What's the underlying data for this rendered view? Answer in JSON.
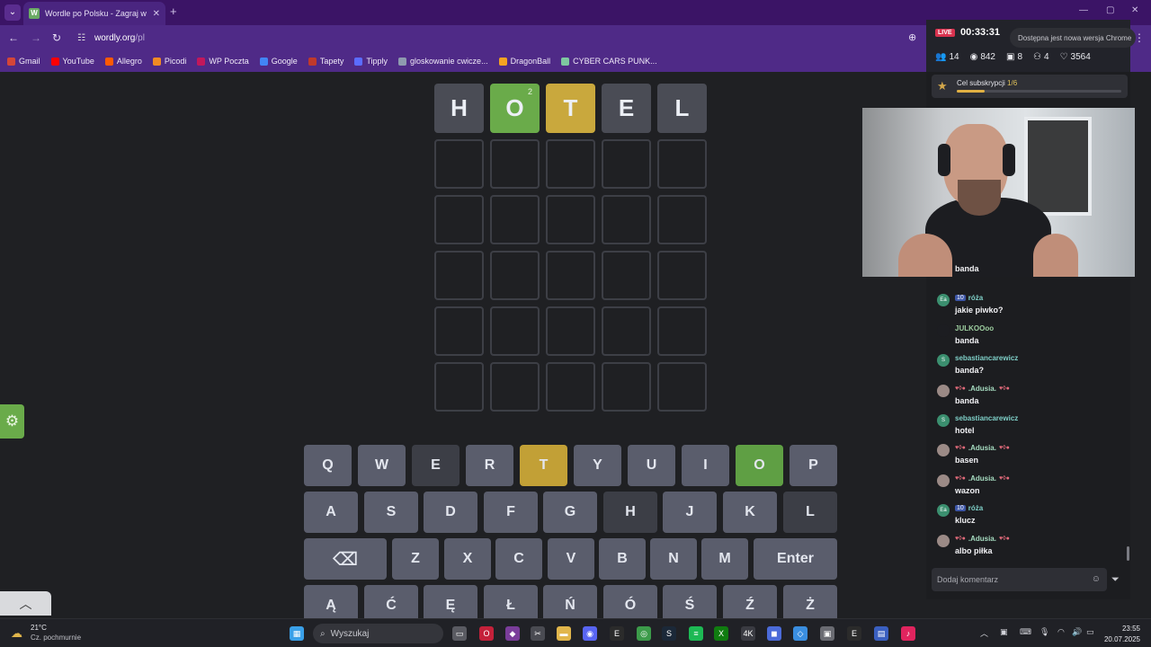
{
  "browser": {
    "tab_title": "Wordle po Polsku - Zagraj w W...",
    "tab_favicon": "W",
    "url_host": "wordly.org",
    "url_path": "/pl",
    "bookmarks": [
      {
        "label": "Gmail",
        "color": "#d44638"
      },
      {
        "label": "YouTube",
        "color": "#ff0000"
      },
      {
        "label": "Allegro",
        "color": "#ff5a00"
      },
      {
        "label": "Picodi",
        "color": "#f08a24"
      },
      {
        "label": "WP Poczta",
        "color": "#c2185b"
      },
      {
        "label": "Google",
        "color": "#4285f4"
      },
      {
        "label": "Tapety",
        "color": "#c0392b"
      },
      {
        "label": "Tipply",
        "color": "#5b6cff"
      },
      {
        "label": "gloskowanie cwicze...",
        "color": "#8e9aaf"
      },
      {
        "label": "DragonBall",
        "color": "#f4a321"
      },
      {
        "label": "CYBER CARS PUNK...",
        "color": "#7ec8a0"
      }
    ]
  },
  "game": {
    "rows": [
      [
        {
          "letter": "H",
          "state": "absent"
        },
        {
          "letter": "O",
          "state": "correct",
          "sup": "2"
        },
        {
          "letter": "T",
          "state": "present"
        },
        {
          "letter": "E",
          "state": "absent"
        },
        {
          "letter": "L",
          "state": "absent"
        }
      ],
      [
        {
          "letter": "",
          "state": "empty"
        },
        {
          "letter": "",
          "state": "empty"
        },
        {
          "letter": "",
          "state": "empty"
        },
        {
          "letter": "",
          "state": "empty"
        },
        {
          "letter": "",
          "state": "empty"
        }
      ],
      [
        {
          "letter": "",
          "state": "empty"
        },
        {
          "letter": "",
          "state": "empty"
        },
        {
          "letter": "",
          "state": "empty"
        },
        {
          "letter": "",
          "state": "empty"
        },
        {
          "letter": "",
          "state": "empty"
        }
      ],
      [
        {
          "letter": "",
          "state": "empty"
        },
        {
          "letter": "",
          "state": "empty"
        },
        {
          "letter": "",
          "state": "empty"
        },
        {
          "letter": "",
          "state": "empty"
        },
        {
          "letter": "",
          "state": "empty"
        }
      ],
      [
        {
          "letter": "",
          "state": "empty"
        },
        {
          "letter": "",
          "state": "empty"
        },
        {
          "letter": "",
          "state": "empty"
        },
        {
          "letter": "",
          "state": "empty"
        },
        {
          "letter": "",
          "state": "empty"
        }
      ],
      [
        {
          "letter": "",
          "state": "empty"
        },
        {
          "letter": "",
          "state": "empty"
        },
        {
          "letter": "",
          "state": "empty"
        },
        {
          "letter": "",
          "state": "empty"
        },
        {
          "letter": "",
          "state": "empty"
        }
      ]
    ],
    "keyboard": [
      [
        {
          "k": "Q",
          "s": ""
        },
        {
          "k": "W",
          "s": ""
        },
        {
          "k": "E",
          "s": "absent"
        },
        {
          "k": "R",
          "s": ""
        },
        {
          "k": "T",
          "s": "present"
        },
        {
          "k": "Y",
          "s": ""
        },
        {
          "k": "U",
          "s": ""
        },
        {
          "k": "I",
          "s": ""
        },
        {
          "k": "O",
          "s": "correct"
        },
        {
          "k": "P",
          "s": ""
        }
      ],
      [
        {
          "k": "A",
          "s": ""
        },
        {
          "k": "S",
          "s": ""
        },
        {
          "k": "D",
          "s": ""
        },
        {
          "k": "F",
          "s": ""
        },
        {
          "k": "G",
          "s": ""
        },
        {
          "k": "H",
          "s": "absent"
        },
        {
          "k": "J",
          "s": ""
        },
        {
          "k": "K",
          "s": ""
        },
        {
          "k": "L",
          "s": "absent"
        }
      ],
      [
        {
          "k": "⌫",
          "s": ""
        },
        {
          "k": "Z",
          "s": ""
        },
        {
          "k": "X",
          "s": ""
        },
        {
          "k": "C",
          "s": ""
        },
        {
          "k": "V",
          "s": ""
        },
        {
          "k": "B",
          "s": ""
        },
        {
          "k": "N",
          "s": ""
        },
        {
          "k": "M",
          "s": ""
        },
        {
          "k": "Enter",
          "s": ""
        }
      ],
      [
        {
          "k": "Ą",
          "s": ""
        },
        {
          "k": "Ć",
          "s": ""
        },
        {
          "k": "Ę",
          "s": ""
        },
        {
          "k": "Ł",
          "s": ""
        },
        {
          "k": "Ń",
          "s": ""
        },
        {
          "k": "Ó",
          "s": ""
        },
        {
          "k": "Ś",
          "s": ""
        },
        {
          "k": "Ź",
          "s": ""
        },
        {
          "k": "Ż",
          "s": ""
        }
      ]
    ]
  },
  "stream": {
    "live_label": "LIVE",
    "timer": "00:33:31",
    "update_notice": "Dostępna jest nowa wersja Chrome",
    "stats": [
      {
        "icon": "users-icon",
        "glyph": "👥",
        "value": "14"
      },
      {
        "icon": "eye-icon",
        "glyph": "◉",
        "value": "842"
      },
      {
        "icon": "gift-icon",
        "glyph": "▣",
        "value": "8"
      },
      {
        "icon": "follower-icon",
        "glyph": "⚇",
        "value": "4"
      },
      {
        "icon": "heart-icon",
        "glyph": "♡",
        "value": "3564"
      }
    ],
    "goal_label": "Cel subskrypcji",
    "goal_value": "1/6",
    "goal_progress": 0.17,
    "comment_placeholder": "Dodaj komentarz",
    "chat": [
      {
        "name": "",
        "text": "banda",
        "color": "#ffffff",
        "avatar": "",
        "avatar_color": "transparent",
        "badge": "",
        "emotes": false
      },
      {
        "name": "róża",
        "text": "jakie piwko?",
        "color": "#7fd0c8",
        "avatar": "Ea",
        "avatar_color": "#3b8f6f",
        "badge": "10",
        "emotes": false
      },
      {
        "name": "JULKOOoo",
        "text": "banda",
        "color": "#9ecfa0",
        "avatar": "",
        "avatar_color": "#1c1d21",
        "badge": "",
        "emotes": false
      },
      {
        "name": "sebastiancarewicz",
        "text": "banda?",
        "color": "#7fd0c8",
        "avatar": "S",
        "avatar_color": "#3b8f6f",
        "badge": "",
        "emotes": false
      },
      {
        "name": ".Adusia.",
        "text": "banda",
        "color": "#a6dcc0",
        "avatar": "",
        "avatar_color": "#9b8a86",
        "badge": "",
        "emotes": true
      },
      {
        "name": "sebastiancarewicz",
        "text": "hotel",
        "color": "#7fd0c8",
        "avatar": "S",
        "avatar_color": "#3b8f6f",
        "badge": "",
        "emotes": false
      },
      {
        "name": ".Adusia.",
        "text": "basen",
        "color": "#a6dcc0",
        "avatar": "",
        "avatar_color": "#9b8a86",
        "badge": "",
        "emotes": true
      },
      {
        "name": ".Adusia.",
        "text": "wazon",
        "color": "#a6dcc0",
        "avatar": "",
        "avatar_color": "#9b8a86",
        "badge": "",
        "emotes": true
      },
      {
        "name": "róża",
        "text": "klucz",
        "color": "#7fd0c8",
        "avatar": "Ea",
        "avatar_color": "#3b8f6f",
        "badge": "10",
        "emotes": false
      },
      {
        "name": ".Adusia.",
        "text": "albo piłka",
        "color": "#a6dcc0",
        "avatar": "",
        "avatar_color": "#9b8a86",
        "badge": "",
        "emotes": true
      }
    ]
  },
  "taskbar": {
    "temperature": "21°C",
    "weather": "Cz. pochmurnie",
    "search_placeholder": "Wyszukaj",
    "time": "23:55",
    "date": "20.07.2025",
    "apps": [
      {
        "name": "windows-start-icon",
        "color": "#3aa0e8",
        "glyph": "▦"
      },
      {
        "name": "task-view-icon",
        "color": "#5a5b62",
        "glyph": "▭"
      },
      {
        "name": "opera-gx-icon",
        "color": "#c4213a",
        "glyph": "O"
      },
      {
        "name": "app-icon",
        "color": "#7a3d9a",
        "glyph": "◆"
      },
      {
        "name": "snipping-icon",
        "color": "#4a4b52",
        "glyph": "✂"
      },
      {
        "name": "file-explorer-icon",
        "color": "#e1b64b",
        "glyph": "▬"
      },
      {
        "name": "discord-icon",
        "color": "#5865f2",
        "glyph": "◉"
      },
      {
        "name": "epic-games-icon",
        "color": "#2b2b2b",
        "glyph": "E"
      },
      {
        "name": "chrome-icon",
        "color": "#3c9b4a",
        "glyph": "◎"
      },
      {
        "name": "steam-icon",
        "color": "#1b2838",
        "glyph": "S"
      },
      {
        "name": "spotify-icon",
        "color": "#1db954",
        "glyph": "≡"
      },
      {
        "name": "xbox-icon",
        "color": "#107c10",
        "glyph": "X"
      },
      {
        "name": "4k-icon",
        "color": "#3a3b42",
        "glyph": "4K"
      },
      {
        "name": "app2-icon",
        "color": "#4b6bd9",
        "glyph": "◼"
      },
      {
        "name": "app3-icon",
        "color": "#3a8ee0",
        "glyph": "◇"
      },
      {
        "name": "app4-icon",
        "color": "#6a6b72",
        "glyph": "▣"
      },
      {
        "name": "epic2-icon",
        "color": "#2b2b2b",
        "glyph": "E"
      },
      {
        "name": "app5-icon",
        "color": "#3a5fc0",
        "glyph": "▤"
      },
      {
        "name": "tiktok-icon",
        "color": "#e0245e",
        "glyph": "♪"
      }
    ]
  }
}
